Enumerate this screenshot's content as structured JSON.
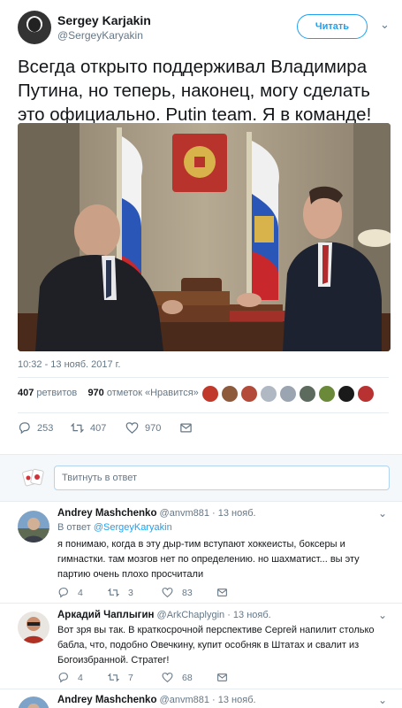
{
  "author": {
    "name": "Sergey Karjakin",
    "handle": "@SergeyKaryakin",
    "follow_label": "Читать"
  },
  "tweet": {
    "text": "Всегда открыто поддерживал Владимира Путина, но теперь, наконец, могу сделать это официально. Putin team. Я в команде!",
    "timestamp": "10:32 - 13 нояб. 2017 г.",
    "retweets_count": "407",
    "retweets_label": "ретвитов",
    "likes_count": "970",
    "likes_label": "отметок «Нравится»",
    "actions": {
      "replies": "253",
      "retweets": "407",
      "likes": "970"
    }
  },
  "likers": [
    "#c0392b",
    "#8e5a3c",
    "#b34a3a",
    "#b0b8c4",
    "#9aa5b1",
    "#5c6b5e",
    "#6a8a3a",
    "#1a1a1a",
    "#b83232"
  ],
  "reply_box": {
    "placeholder": "Твитнуть в ответ"
  },
  "replies": [
    {
      "name": "Andrey Mashchenko",
      "handle": "@anvm881",
      "date": "· 13 нояб.",
      "reply_to_label": "В ответ",
      "reply_to_handle": "@SergeyKaryakin",
      "text": "я понимаю, когда в эту дыр-тим вступают хоккеисты, боксеры и гимнастки. там мозгов нет по определению. но шахматист... вы эту партию очень плохо просчитали",
      "replies": "4",
      "retweets": "3",
      "likes": "83"
    },
    {
      "name": "Аркадий Чаплыгин",
      "handle": "@ArkChaplygin",
      "date": "· 13 нояб.",
      "text": "Вот зря вы так. В краткосрочной перспективе Сергей напилит столько бабла, что, подобно Овечкину, купит особняк в Штатах и свалит из Богоизбранной. Стратег!",
      "replies": "4",
      "retweets": "7",
      "likes": "68"
    },
    {
      "name": "Andrey Mashchenko",
      "handle": "@anvm881",
      "date": "· 13 нояб."
    }
  ]
}
